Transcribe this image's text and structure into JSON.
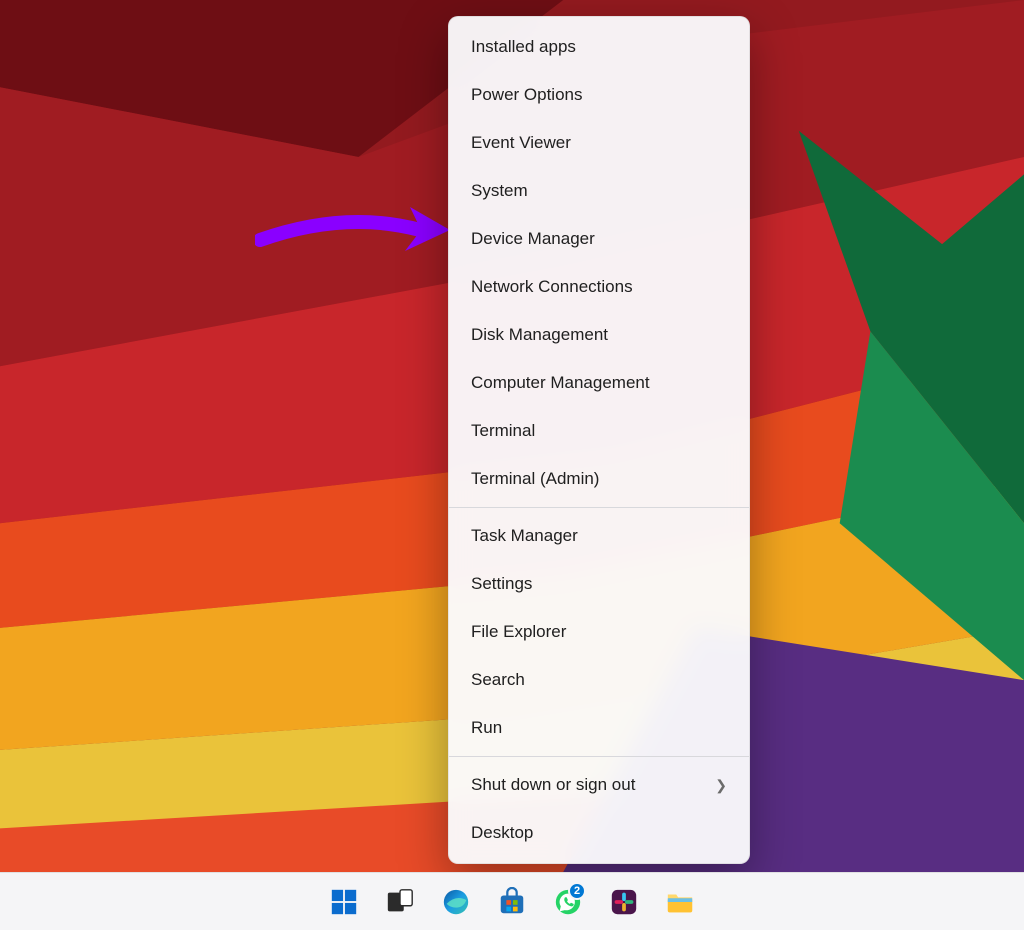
{
  "context_menu": {
    "group1": [
      "Installed apps",
      "Power Options",
      "Event Viewer",
      "System",
      "Device Manager",
      "Network Connections",
      "Disk Management",
      "Computer Management",
      "Terminal",
      "Terminal (Admin)"
    ],
    "group2": [
      "Task Manager",
      "Settings",
      "File Explorer",
      "Search",
      "Run"
    ],
    "group3": [
      {
        "label": "Shut down or sign out",
        "submenu": true
      },
      {
        "label": "Desktop",
        "submenu": false
      }
    ]
  },
  "annotation": {
    "target_item": "Device Manager",
    "color": "#8a00ff"
  },
  "taskbar": {
    "icons": [
      {
        "name": "start",
        "label": "Start"
      },
      {
        "name": "taskview",
        "label": "Task View"
      },
      {
        "name": "edge",
        "label": "Microsoft Edge"
      },
      {
        "name": "store",
        "label": "Microsoft Store"
      },
      {
        "name": "whatsapp",
        "label": "WhatsApp",
        "badge": "2"
      },
      {
        "name": "slack",
        "label": "Slack"
      },
      {
        "name": "explorer",
        "label": "File Explorer"
      }
    ]
  }
}
